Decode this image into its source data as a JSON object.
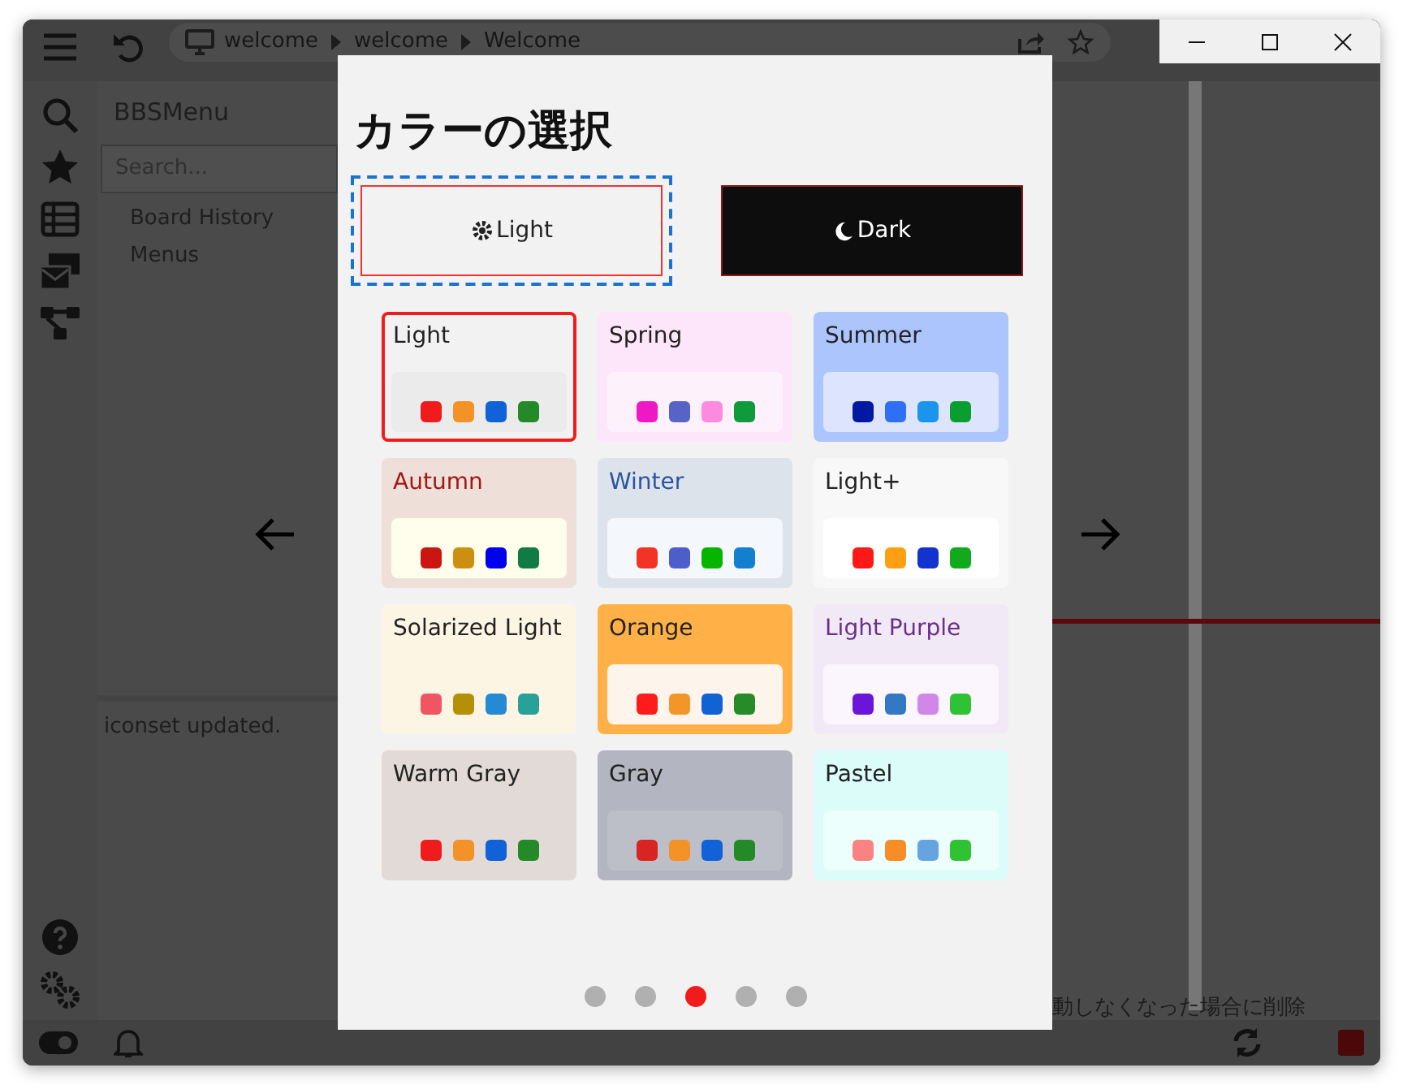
{
  "toolbar": {
    "breadcrumbs": [
      "welcome",
      "welcome",
      "Welcome"
    ]
  },
  "sidebar": {
    "title": "BBSMenu",
    "search": {
      "placeholder": "Search..."
    },
    "items": [
      "Board History",
      "Menus"
    ]
  },
  "log": {
    "message": "iconset updated."
  },
  "footer_text": "動しなくなった場合に削除",
  "dialog": {
    "title": "カラーの選択",
    "modes": [
      {
        "label": "Light",
        "kind": "light",
        "selected": true
      },
      {
        "label": "Dark",
        "kind": "dark",
        "selected": false
      }
    ],
    "themes": [
      {
        "name": "Light",
        "selected": true,
        "color": "#f2f2f2",
        "label": {
          "color": "#222222"
        },
        "panel": {
          "color": "#ebebeb"
        },
        "swatches": [
          {
            "color": "#f01c1c"
          },
          {
            "color": "#f39226"
          },
          {
            "color": "#1062d6"
          },
          {
            "color": "#238a27"
          }
        ]
      },
      {
        "name": "Spring",
        "selected": false,
        "color": "#fde6f9",
        "label": {
          "color": "#222222"
        },
        "panel": {
          "color": "#fdf1fb"
        },
        "swatches": [
          {
            "color": "#ee18c4"
          },
          {
            "color": "#5863c6"
          },
          {
            "color": "#fd8ade"
          },
          {
            "color": "#0f9a3c"
          }
        ]
      },
      {
        "name": "Summer",
        "selected": false,
        "color": "#adc5fd",
        "label": {
          "color": "#222222"
        },
        "panel": {
          "color": "#dce4fe"
        },
        "swatches": [
          {
            "color": "#0019a0"
          },
          {
            "color": "#2f6ff5"
          },
          {
            "color": "#1a94ec"
          },
          {
            "color": "#0a9d30"
          }
        ]
      },
      {
        "name": "Autumn",
        "selected": false,
        "color": "#eedfd8",
        "label": {
          "color": "#a01818"
        },
        "panel": {
          "color": "#fffdeb"
        },
        "swatches": [
          {
            "color": "#cb1511"
          },
          {
            "color": "#cd8f0f"
          },
          {
            "color": "#0000f0"
          },
          {
            "color": "#117b45"
          }
        ]
      },
      {
        "name": "Winter",
        "selected": false,
        "color": "#dde3ea",
        "label": {
          "color": "#2a55a0"
        },
        "panel": {
          "color": "#f4f8fd"
        },
        "swatches": [
          {
            "color": "#f23426"
          },
          {
            "color": "#4d5ecb"
          },
          {
            "color": "#05b500"
          },
          {
            "color": "#127fcf"
          }
        ]
      },
      {
        "name": "Light+",
        "selected": false,
        "color": "#f8f8f8",
        "label": {
          "color": "#222222"
        },
        "panel": {
          "color": "#ffffff"
        },
        "swatches": [
          {
            "color": "#fe1818"
          },
          {
            "color": "#ff9f14"
          },
          {
            "color": "#1233cf"
          },
          {
            "color": "#10aa1c"
          }
        ]
      },
      {
        "name": "Solarized Light",
        "selected": false,
        "color": "#fcf5e4",
        "label": {
          "color": "#222222"
        },
        "panel": {
          "color": "#fcf5e4"
        },
        "swatches": [
          {
            "color": "#ef5662"
          },
          {
            "color": "#b58f05"
          },
          {
            "color": "#258ad3"
          },
          {
            "color": "#2aa198"
          }
        ]
      },
      {
        "name": "Orange",
        "selected": false,
        "color": "#ffb047",
        "label": {
          "color": "#222222"
        },
        "panel": {
          "color": "#fdf4ec"
        },
        "swatches": [
          {
            "color": "#fe1b1b"
          },
          {
            "color": "#f3962a"
          },
          {
            "color": "#1163d4"
          },
          {
            "color": "#258c28"
          }
        ]
      },
      {
        "name": "Light Purple",
        "selected": false,
        "color": "#f1eaf6",
        "label": {
          "color": "#6a2f8a"
        },
        "panel": {
          "color": "#fbf6fd"
        },
        "swatches": [
          {
            "color": "#6a15d8"
          },
          {
            "color": "#3478c3"
          },
          {
            "color": "#d187ea"
          },
          {
            "color": "#2fc234"
          }
        ]
      },
      {
        "name": "Warm Gray",
        "selected": false,
        "color": "#e2dad7",
        "label": {
          "color": "#222222"
        },
        "panel": {
          "color": "#e2dad7"
        },
        "swatches": [
          {
            "color": "#f01c1c"
          },
          {
            "color": "#f39226"
          },
          {
            "color": "#1062d6"
          },
          {
            "color": "#238a27"
          }
        ]
      },
      {
        "name": "Gray",
        "selected": false,
        "color": "#b3b5c0",
        "label": {
          "color": "#222222"
        },
        "panel": {
          "color": "#bcbfc7"
        },
        "swatches": [
          {
            "color": "#d92424"
          },
          {
            "color": "#f39226"
          },
          {
            "color": "#1062d6"
          },
          {
            "color": "#238a27"
          }
        ]
      },
      {
        "name": "Pastel",
        "selected": false,
        "color": "#dbfcf9",
        "label": {
          "color": "#222222"
        },
        "panel": {
          "color": "#ecfffd"
        },
        "swatches": [
          {
            "color": "#f98383"
          },
          {
            "color": "#f68d26"
          },
          {
            "color": "#64a4e0"
          },
          {
            "color": "#2fc233"
          }
        ]
      }
    ],
    "pager": [
      {
        "selected": false
      },
      {
        "selected": false
      },
      {
        "selected": true
      },
      {
        "selected": false
      },
      {
        "selected": false
      }
    ]
  }
}
